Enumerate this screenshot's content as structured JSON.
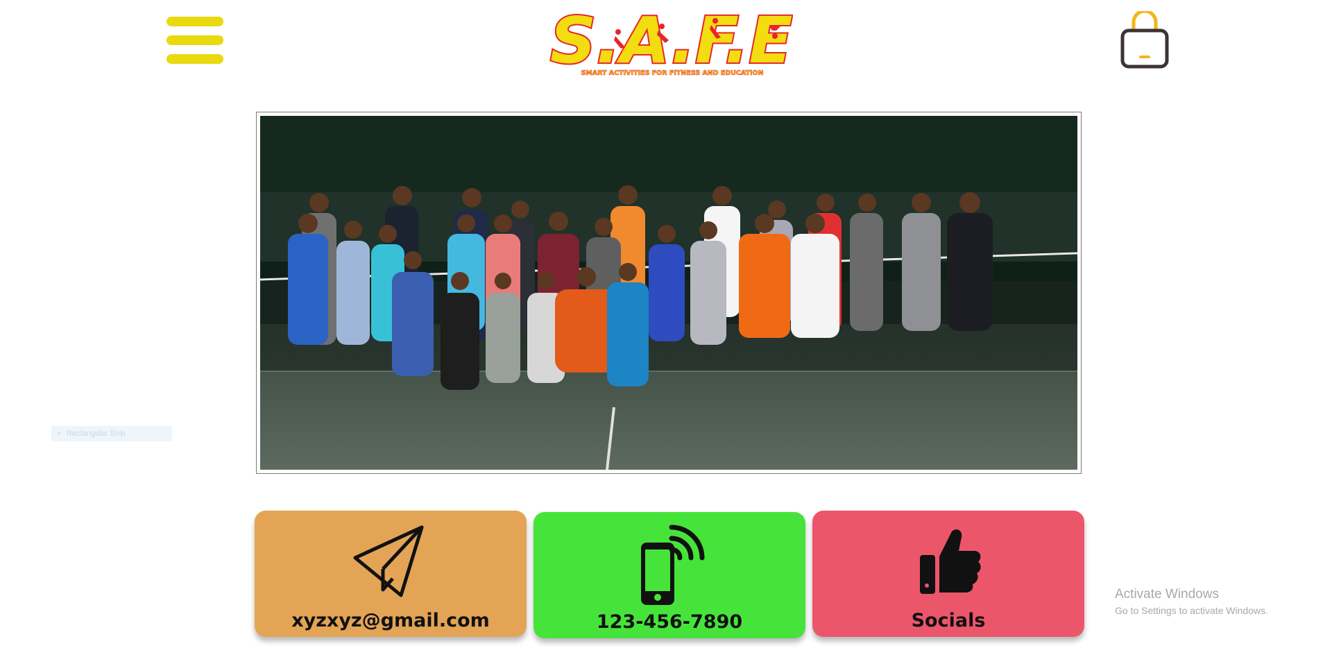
{
  "header": {
    "menu_icon": "hamburger-menu-icon",
    "logo": {
      "text": "S.A.F.E.",
      "tagline": "SMART ACTIVITIES FOR FITNESS AND EDUCATION",
      "color_primary": "#f3dc10",
      "color_secondary": "#e5262b"
    },
    "cart_icon": "shopping-bag-icon",
    "accent": "#ead90f"
  },
  "hero": {
    "description_icon": "group-photo"
  },
  "snip_tool": {
    "label": "Rectangular Snip"
  },
  "contacts": [
    {
      "label": "xyzxyz@gmail.com",
      "icon": "paper-plane-icon",
      "color": "#e3a456"
    },
    {
      "label": "123-456-7890",
      "icon": "mobile-phone-signal-icon",
      "color": "#46e43a"
    },
    {
      "label": "Socials",
      "icon": "thumbs-up-icon",
      "color": "#ec566b"
    }
  ],
  "os_watermark": {
    "title": "Activate Windows",
    "subtitle": "Go to Settings to activate Windows."
  }
}
